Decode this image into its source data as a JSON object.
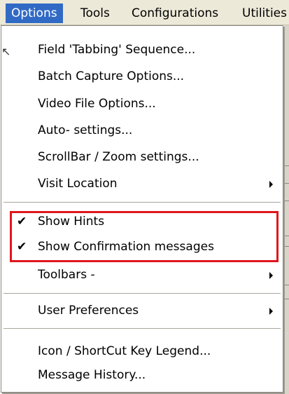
{
  "menubar": {
    "items": [
      "Options",
      "Tools",
      "Configurations",
      "Utilities"
    ]
  },
  "dropdown": {
    "items": [
      {
        "label": "Field 'Tabbing' Sequence..."
      },
      {
        "label": "Batch Capture Options..."
      },
      {
        "label": "Video File Options..."
      },
      {
        "label": "Auto- settings..."
      },
      {
        "label": "ScrollBar / Zoom settings..."
      },
      {
        "label": "Visit Location",
        "submenu": true
      },
      {
        "label": "Show Hints",
        "checked": true
      },
      {
        "label": "Show Confirmation messages",
        "checked": true
      },
      {
        "label": "Toolbars -",
        "submenu": true
      },
      {
        "label": "User Preferences",
        "submenu": true
      },
      {
        "label": "Icon / ShortCut Key Legend..."
      },
      {
        "label": "Message History..."
      }
    ],
    "check_glyph": "✔"
  },
  "colors": {
    "menubar_bg": "#ece9d8",
    "active_bg": "#316ac5",
    "highlight_border": "#e0161b"
  }
}
